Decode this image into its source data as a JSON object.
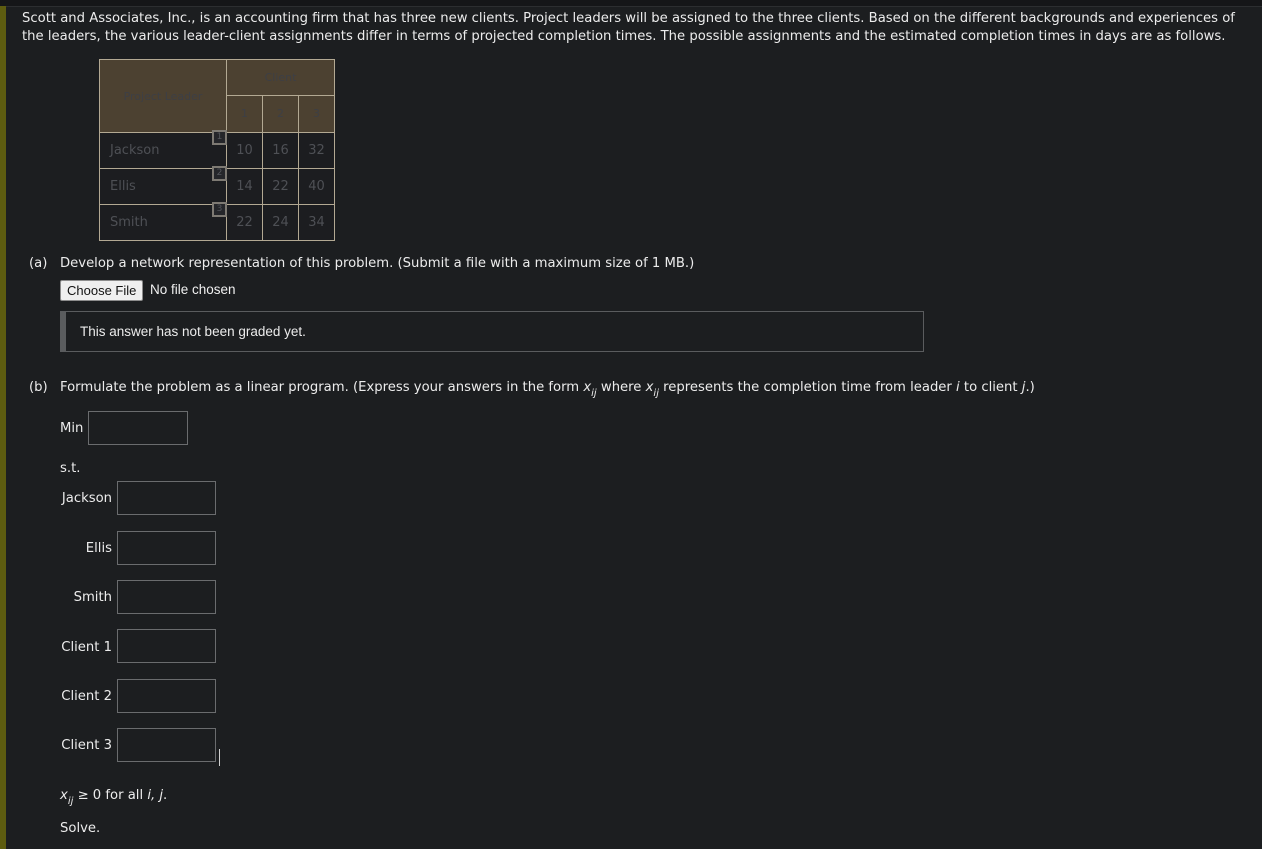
{
  "intro_text": "Scott and Associates, Inc., is an accounting firm that has three new clients. Project leaders will be assigned to the three clients. Based on the different backgrounds and experiences of the leaders, the various leader-client assignments differ in terms of projected completion times. The possible assignments and the estimated completion times in days are as follows.",
  "table": {
    "header_leader": "Project Leader",
    "header_client": "Client",
    "client_columns": [
      "1",
      "2",
      "3"
    ],
    "rows": [
      {
        "marker": "1",
        "leader": "Jackson",
        "values": [
          "10",
          "16",
          "32"
        ]
      },
      {
        "marker": "2",
        "leader": "Ellis",
        "values": [
          "14",
          "22",
          "40"
        ]
      },
      {
        "marker": "3",
        "leader": "Smith",
        "values": [
          "22",
          "24",
          "34"
        ]
      }
    ]
  },
  "part_a": {
    "label": "(a)",
    "question": "Develop a network representation of this problem. (Submit a file with a maximum size of 1 MB.)",
    "choose_file_label": "Choose File",
    "file_status": "No file chosen",
    "graded_message": "This answer has not been graded yet."
  },
  "part_b": {
    "label": "(b)",
    "question_prefix": "Formulate the problem as a linear program. (Express your answers in the form ",
    "var_x": "x",
    "var_sub": "ij",
    "question_mid": " where ",
    "question_mid2": " represents the completion time from leader ",
    "var_i": "i",
    "question_mid3": " to client ",
    "var_j": "j",
    "question_end": ".)",
    "min_label": "Min",
    "st_label": "s.t.",
    "constraints": [
      {
        "label": "Jackson",
        "value": ""
      },
      {
        "label": "Ellis",
        "value": ""
      },
      {
        "label": "Smith",
        "value": ""
      },
      {
        "label": "Client 1",
        "value": ""
      },
      {
        "label": "Client 2",
        "value": ""
      },
      {
        "label": "Client 3",
        "value": ""
      }
    ],
    "min_value": "",
    "nonneg_text": " ≥ 0 for all ",
    "nonneg_vars": "i, j",
    "nonneg_end": ".",
    "solve_label": "Solve."
  }
}
